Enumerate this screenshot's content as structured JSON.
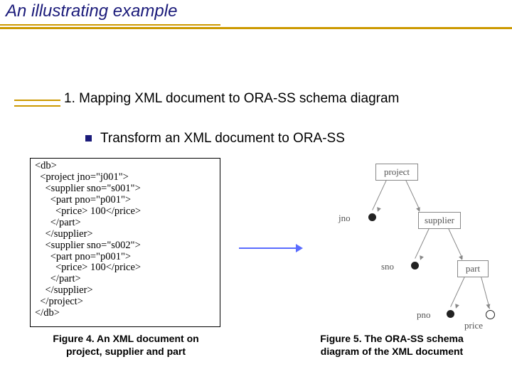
{
  "title": "An illustrating example",
  "section_number": "1.",
  "section_text": "Mapping XML document to ORA-SS schema diagram",
  "bullet_text": "Transform an XML document to ORA-SS",
  "xml_code": "<db>\n  <project jno=\"j001\">\n    <supplier sno=\"s001\">\n      <part pno=\"p001\">\n        <price> 100</price>\n      </part>\n    </supplier>\n    <supplier sno=\"s002\">\n      <part pno=\"p001\">\n        <price> 100</price>\n      </part>\n    </supplier>\n  </project>\n</db>",
  "figure4_caption": "Figure 4. An XML document on project, supplier and part",
  "figure5_caption": "Figure 5. The ORA-SS schema diagram of the XML document",
  "diagram": {
    "nodes": {
      "project": "project",
      "supplier": "supplier",
      "part": "part",
      "jno": "jno",
      "sno": "sno",
      "pno": "pno",
      "price": "price"
    }
  }
}
